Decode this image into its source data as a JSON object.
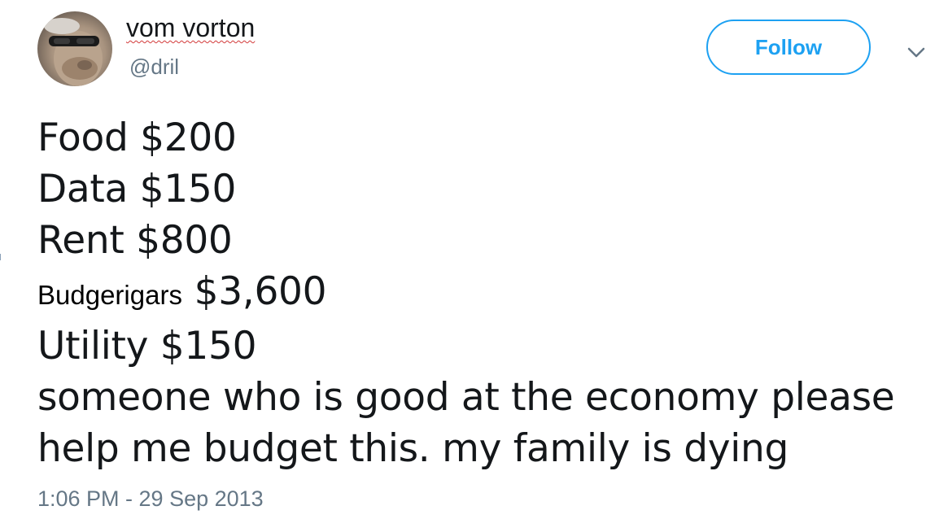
{
  "user": {
    "display_name": "vom vorton",
    "handle": "@dril"
  },
  "actions": {
    "follow_label": "Follow",
    "menu_icon": "chevron-down-icon"
  },
  "tweet": {
    "lines": [
      "Food $200",
      "Data $150",
      "Rent $800",
      "Utility $150",
      "someone who is good at the economy please",
      "help me budget this. my family is dying"
    ],
    "budgie_label": "Budgerigars",
    "budgie_amount": "$3,600",
    "timestamp": "1:06 PM - 29 Sep 2013"
  },
  "colors": {
    "accent": "#1da1f2",
    "text": "#14171a",
    "muted": "#657786"
  }
}
